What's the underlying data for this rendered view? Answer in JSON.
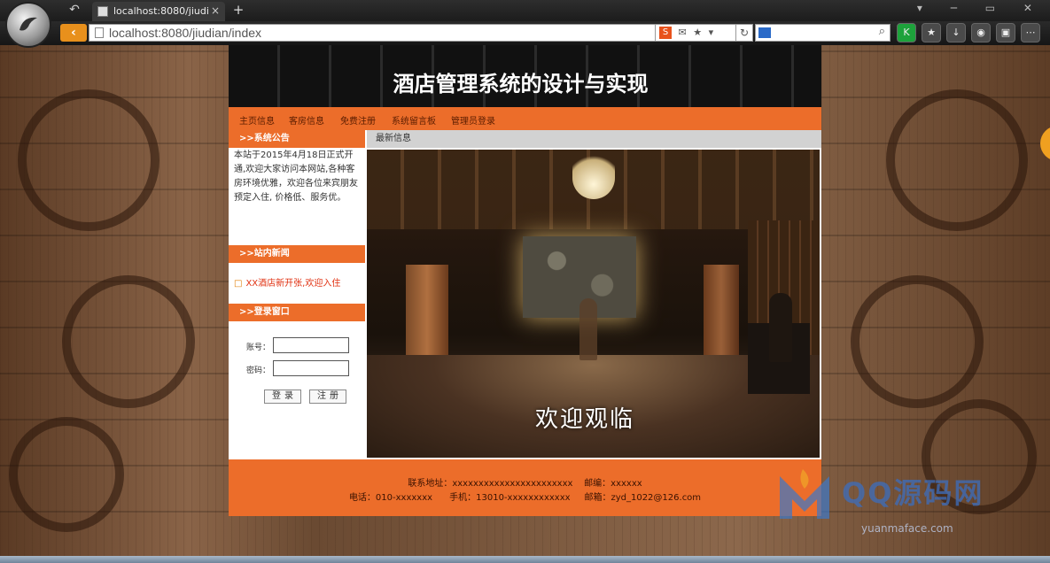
{
  "browser": {
    "tab_title": "localhost:8080/jiudi",
    "tab_close": "×",
    "new_tab": "+",
    "back_arrow": "‹",
    "url": "localhost:8080/jiudian/index",
    "window_controls": "▾ ─ ▭ ✕",
    "icons": [
      "back-icon",
      "page-icon",
      "bookmark-star-icon",
      "refresh-icon",
      "search-engine-icon",
      "search-icon",
      "kaspersky-icon",
      "star-icon",
      "download-icon",
      "gamepad-icon",
      "printer-icon",
      "menu-icon"
    ]
  },
  "site": {
    "banner_title": "酒店管理系统的设计与实现",
    "nav": [
      "主页信息",
      "客房信息",
      "免费注册",
      "系统留言板",
      "管理员登录"
    ],
    "notice": {
      "heading": ">>系统公告",
      "text": "本站于2015年4月18日正式开通,欢迎大家访问本网站,各种客房环境优雅，欢迎各位来宾朋友预定入住, 价格低、服务优。"
    },
    "news": {
      "heading": ">>站内新闻",
      "items": [
        "XX酒店新开张,欢迎入住"
      ]
    },
    "login": {
      "heading": ">>登录窗口",
      "account_label": "账号：",
      "password_label": "密码：",
      "login_button": "登录",
      "register_button": "注册"
    },
    "main": {
      "heading": "最新信息",
      "hero_caption": "欢迎观临"
    },
    "footer": {
      "line1": "联系地址：xxxxxxxxxxxxxxxxxxxxxxx    邮编：xxxxxx",
      "line2": "电话：010-xxxxxxx      手机：13010-xxxxxxxxxxxx     邮箱：zyd_1022@126.com"
    }
  },
  "watermark": {
    "brand": "QQ源码网",
    "url": "yuanmaface.com"
  },
  "colors": {
    "accent": "#ec6d2a",
    "banner": "#111111",
    "news_link": "#e03010"
  }
}
